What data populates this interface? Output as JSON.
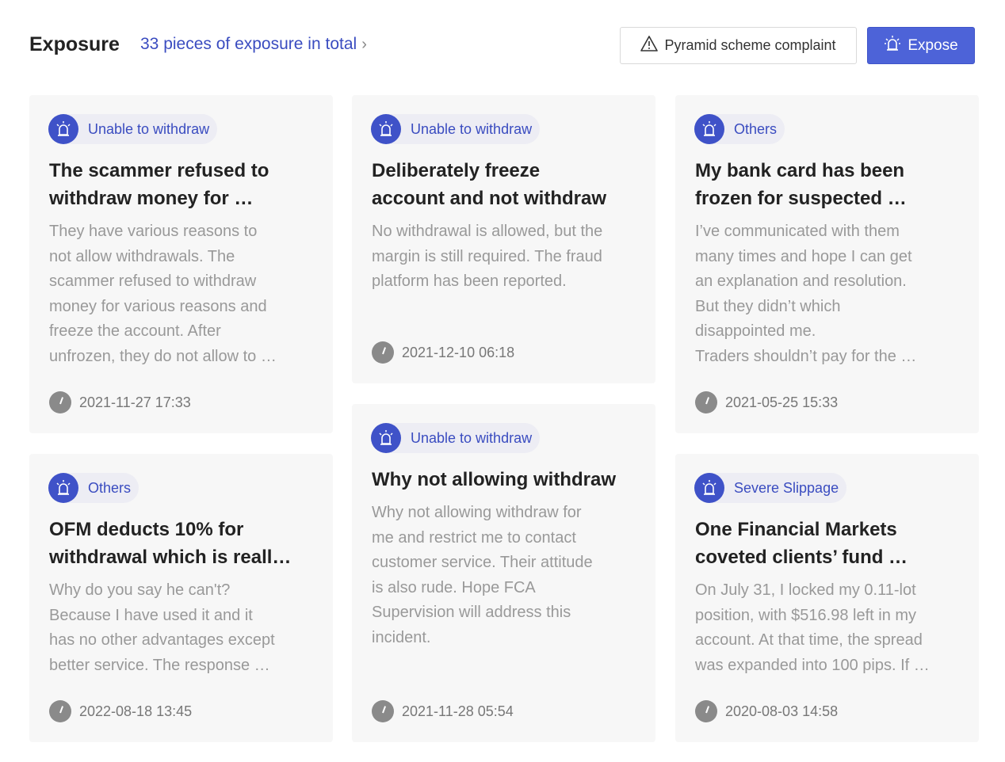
{
  "header": {
    "title": "Exposure",
    "total_link": "33 pieces of exposure in total",
    "complaint_button": "Pyramid scheme complaint",
    "expose_button": "Expose"
  },
  "cards": [
    {
      "tag": "Unable to withdraw",
      "title_line1": "The scammer refused to",
      "title_line2": "withdraw money for …",
      "desc_lines": [
        "They have various reasons to",
        "not allow withdrawals. The",
        "scammer refused to withdraw",
        "money for various reasons and",
        "freeze the account. After",
        "unfrozen, they do not allow to …"
      ],
      "time": "2021-11-27 17:33"
    },
    {
      "tag": "Unable to withdraw",
      "title_line1": "Deliberately freeze",
      "title_line2": "account and not withdraw",
      "desc_lines": [
        "No withdrawal is allowed, but the",
        "margin is still required. The fraud",
        "platform has been reported."
      ],
      "time": "2021-12-10 06:18"
    },
    {
      "tag": "Others",
      "title_line1": "My bank card has been",
      "title_line2": "frozen for suspected …",
      "desc_lines": [
        "I’ve communicated with them",
        "many times and hope I can get",
        "an explanation and resolution.",
        "But they didn’t which",
        "disappointed me.",
        "Traders shouldn’t pay for the …"
      ],
      "time": "2021-05-25 15:33"
    },
    {
      "tag": "Others",
      "title_line1": "OFM deducts 10% for",
      "title_line2": "withdrawal which is reall…",
      "desc_lines": [
        "Why do you say he can't?",
        "Because I have used it and it",
        "has no other advantages except",
        "better service. The response …"
      ],
      "time": "2022-08-18 13:45"
    },
    {
      "tag": "Unable to withdraw",
      "title_line1": "Why not allowing withdraw",
      "title_line2": "",
      "desc_lines": [
        "Why not allowing withdraw for",
        "me and restrict me to contact",
        "customer service. Their attitude",
        "is also rude. Hope FCA",
        "Supervision will address this",
        "incident."
      ],
      "time": "2021-11-28 05:54"
    },
    {
      "tag": "Severe Slippage",
      "title_line1": "One Financial Markets",
      "title_line2": "coveted clients’ fund …",
      "desc_lines": [
        "On July 31, I locked my 0.11-lot",
        "position, with $516.98 left in my",
        "account. At that time, the spread",
        "was expanded into 100 pips. If …"
      ],
      "time": "2020-08-03 14:58"
    }
  ]
}
